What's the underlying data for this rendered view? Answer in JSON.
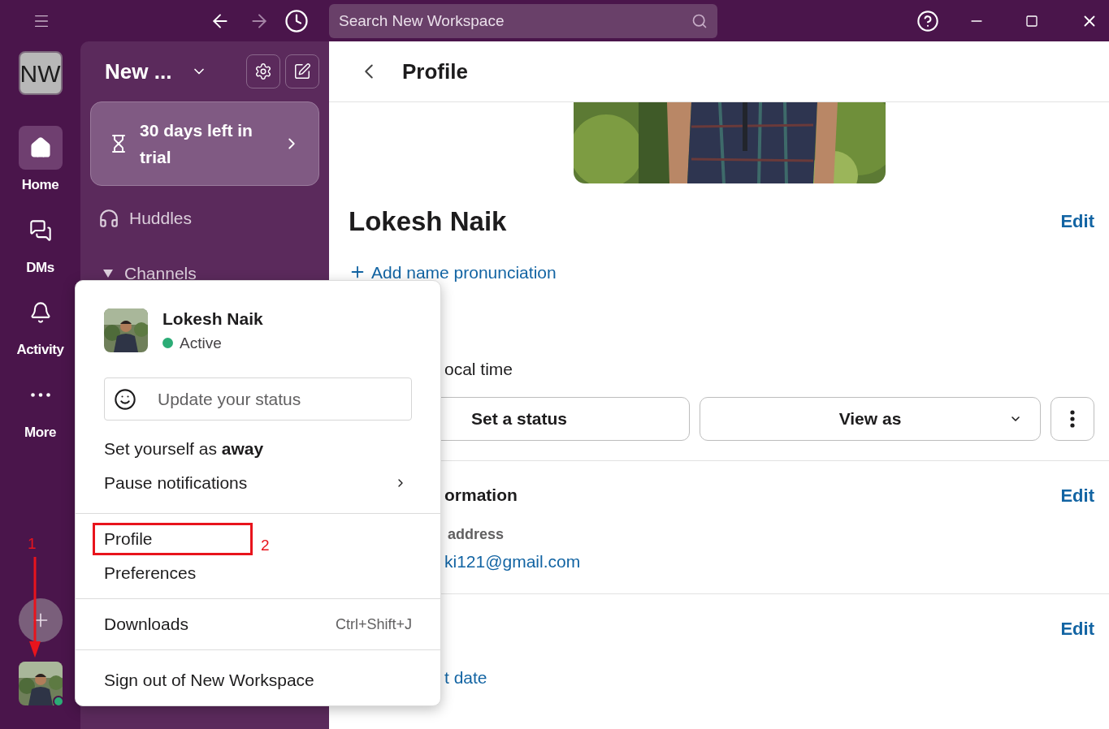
{
  "top_bar": {
    "search": {
      "placeholder": "Search New Workspace"
    }
  },
  "workspace": {
    "initials": "NW"
  },
  "rail": [
    {
      "label": "Home",
      "selected": true
    },
    {
      "label": "DMs",
      "selected": false
    },
    {
      "label": "Activity",
      "selected": false
    },
    {
      "label": "More",
      "selected": false
    }
  ],
  "sidebar": {
    "title": "New ...",
    "trial": "30 days left in trial",
    "items": [
      {
        "label": "Huddles"
      }
    ],
    "section": "Channels"
  },
  "profile": {
    "header": "Profile",
    "name": "Lokesh Naik",
    "edit": "Edit",
    "pronunciation": "Add name pronunciation",
    "local_time": "ocal time",
    "buttons": [
      {
        "label": "Set a status",
        "kind": "plain"
      },
      {
        "label": "View as",
        "kind": "dropdown"
      }
    ],
    "contact": {
      "title": "ormation",
      "edit": "Edit",
      "label": "address",
      "email": "ki121@gmail.com"
    },
    "section_3": {
      "edit": "Edit",
      "link": "t date"
    }
  },
  "menu": {
    "user": {
      "name": "Lokesh Naik",
      "status": "Active",
      "active": true
    },
    "status_field": {
      "placeholder": "Update your status"
    },
    "groups": [
      [
        {
          "label": "Set yourself as **away**",
          "submenu": false,
          "annotated": false
        },
        {
          "label": "Pause notifications",
          "submenu": true,
          "annotated": false
        }
      ],
      [
        {
          "label": "Profile",
          "submenu": false,
          "annotated": true
        },
        {
          "label": "Preferences",
          "submenu": false,
          "annotated": false
        }
      ],
      [
        {
          "label": "Downloads",
          "shortcut": "Ctrl+Shift+J",
          "submenu": false,
          "annotated": false
        }
      ],
      [
        {
          "label": "Sign out of New Workspace",
          "submenu": false,
          "annotated": false
        }
      ]
    ]
  },
  "annotations": [
    {
      "label": "1"
    },
    {
      "label": "2"
    }
  ]
}
